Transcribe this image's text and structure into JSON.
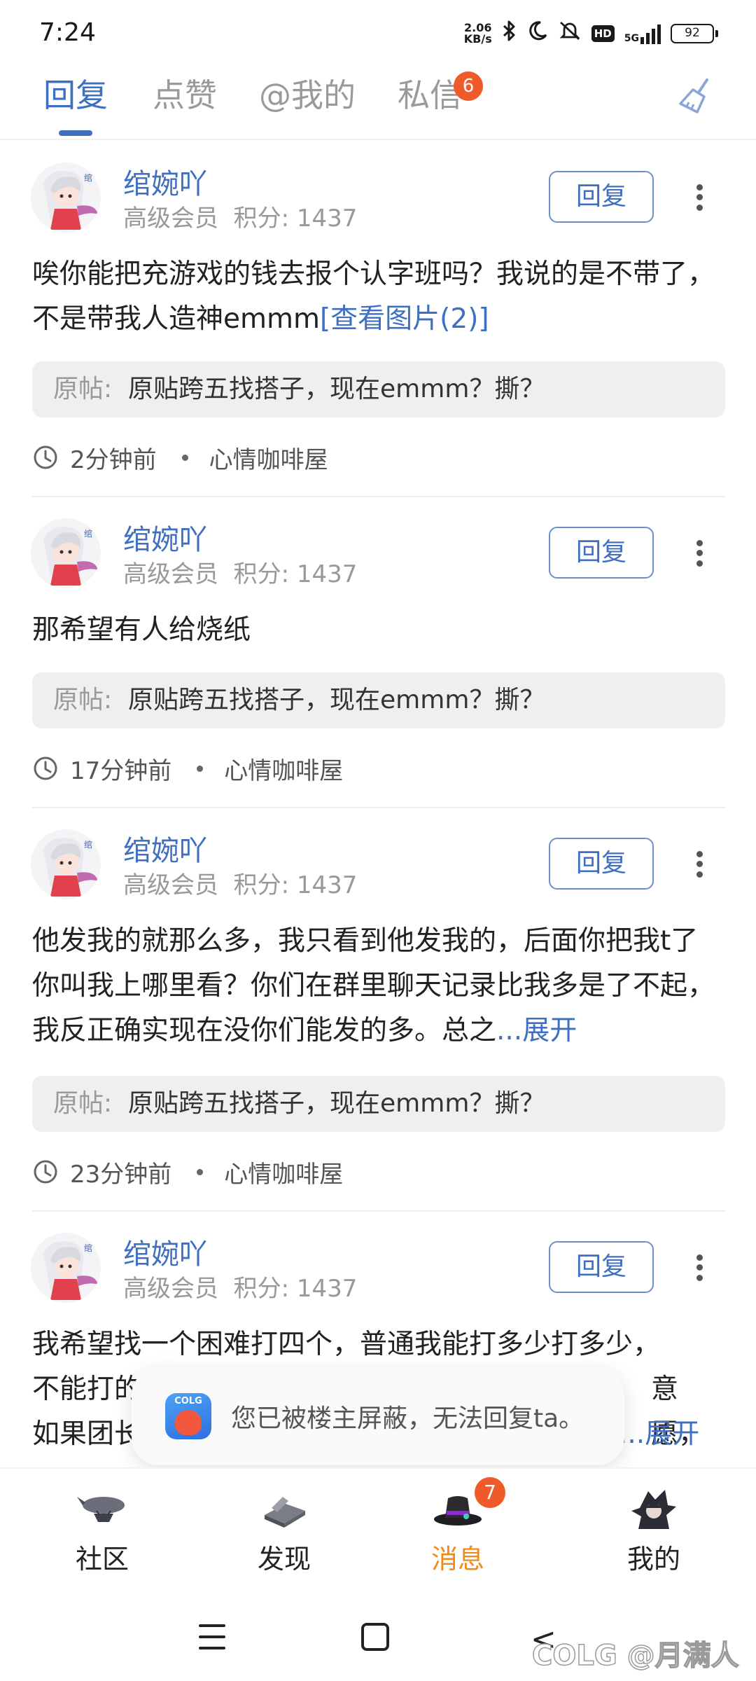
{
  "status_bar": {
    "time": "7:24",
    "net_speed_value": "2.06",
    "net_speed_unit": "KB/s",
    "hd": "HD",
    "network": "5G",
    "battery": "92"
  },
  "tabs": [
    {
      "label": "回复",
      "active": true
    },
    {
      "label": "点赞",
      "active": false
    },
    {
      "label": "@我的",
      "active": false
    },
    {
      "label": "私信",
      "active": false,
      "badge": "6"
    }
  ],
  "accent_color": "#3f6fc0",
  "badge_color": "#f05a2a",
  "active_nav_color": "#f08a1a",
  "replies": [
    {
      "user": "绾婉吖",
      "level": "高级会员",
      "score": "积分: 1437",
      "reply_label": "回复",
      "content": "唉你能把充游戏的钱去报个认字班吗？我说的是不带了，不是带我人造神emmm",
      "content_link": "[查看图片(2)]",
      "quote_label": "原帖:",
      "quote_text": "原贴跨五找搭子，现在emmm？撕？",
      "time": "2分钟前",
      "forum": "心情咖啡屋"
    },
    {
      "user": "绾婉吖",
      "level": "高级会员",
      "score": "积分: 1437",
      "reply_label": "回复",
      "content": "那希望有人给烧纸",
      "content_link": "",
      "quote_label": "原帖:",
      "quote_text": "原贴跨五找搭子，现在emmm？撕？",
      "time": "17分钟前",
      "forum": "心情咖啡屋"
    },
    {
      "user": "绾婉吖",
      "level": "高级会员",
      "score": "积分: 1437",
      "reply_label": "回复",
      "content": "他发我的就那么多，我只看到他发我的，后面你把我t了你叫我上哪里看？你们在群里聊天记录比我多是了不起，我反正确实现在没你们能发的多。总之",
      "content_link": "...展开",
      "quote_label": "原帖:",
      "quote_text": "原贴跨五找搭子，现在emmm？撕？",
      "time": "23分钟前",
      "forum": "心情咖啡屋"
    },
    {
      "user": "绾婉吖",
      "level": "高级会员",
      "score": "积分: 1437",
      "reply_label": "回复",
      "content_lines": [
        "我希望找一个困难打四个，普通我能打多少打多少，",
        "不能打的",
        "意愿，",
        "如果团长"
      ],
      "content_link": "...展开"
    }
  ],
  "toast": {
    "app_label": "COLG",
    "text": "您已被楼主屏蔽，无法回复ta。"
  },
  "bottom_nav": [
    {
      "label": "社区",
      "icon": "airship-icon",
      "active": false
    },
    {
      "label": "发现",
      "icon": "book-icon",
      "active": false
    },
    {
      "label": "消息",
      "icon": "top-hat-icon",
      "active": true,
      "badge": "7"
    },
    {
      "label": "我的",
      "icon": "character-avatar-icon",
      "active": false
    }
  ],
  "watermark": "COLG @月满人间"
}
